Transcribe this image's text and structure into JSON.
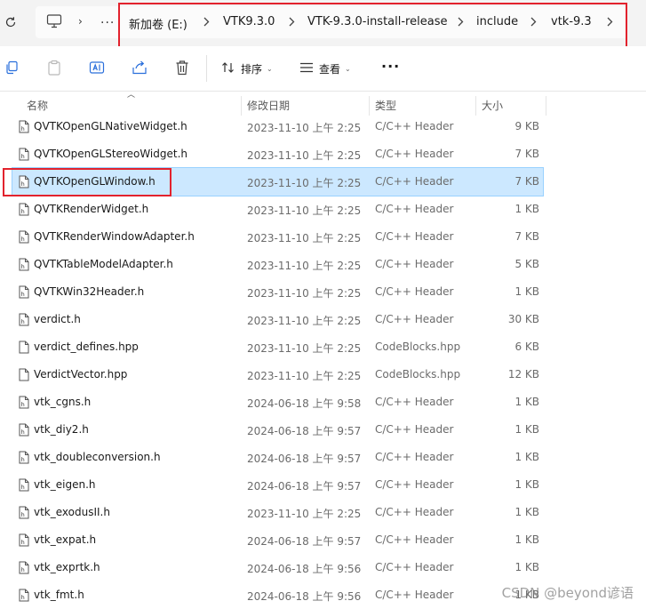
{
  "address": {
    "more": "...",
    "crumbs": [
      "新加卷 (E:)",
      "VTK9.3.0",
      "VTK-9.3.0-install-release",
      "include",
      "vtk-9.3"
    ]
  },
  "toolbar": {
    "sort_label": "排序",
    "view_label": "查看",
    "more_label": "···"
  },
  "columns": {
    "name": "名称",
    "modified": "修改日期",
    "type": "类型",
    "size": "大小"
  },
  "files": [
    {
      "name": "QVTKOpenGLNativeWidget.h",
      "modified": "2023-11-10 上午 2:25",
      "type": "C/C++ Header",
      "size": "9 KB",
      "icon": "header-file-icon"
    },
    {
      "name": "QVTKOpenGLStereoWidget.h",
      "modified": "2023-11-10 上午 2:25",
      "type": "C/C++ Header",
      "size": "7 KB",
      "icon": "header-file-icon"
    },
    {
      "name": "QVTKOpenGLWindow.h",
      "modified": "2023-11-10 上午 2:25",
      "type": "C/C++ Header",
      "size": "7 KB",
      "icon": "header-file-icon"
    },
    {
      "name": "QVTKRenderWidget.h",
      "modified": "2023-11-10 上午 2:25",
      "type": "C/C++ Header",
      "size": "1 KB",
      "icon": "header-file-icon"
    },
    {
      "name": "QVTKRenderWindowAdapter.h",
      "modified": "2023-11-10 上午 2:25",
      "type": "C/C++ Header",
      "size": "7 KB",
      "icon": "header-file-icon"
    },
    {
      "name": "QVTKTableModelAdapter.h",
      "modified": "2023-11-10 上午 2:25",
      "type": "C/C++ Header",
      "size": "5 KB",
      "icon": "header-file-icon"
    },
    {
      "name": "QVTKWin32Header.h",
      "modified": "2023-11-10 上午 2:25",
      "type": "C/C++ Header",
      "size": "1 KB",
      "icon": "header-file-icon"
    },
    {
      "name": "verdict.h",
      "modified": "2023-11-10 上午 2:25",
      "type": "C/C++ Header",
      "size": "30 KB",
      "icon": "header-file-icon"
    },
    {
      "name": "verdict_defines.hpp",
      "modified": "2023-11-10 上午 2:25",
      "type": "CodeBlocks.hpp",
      "size": "6 KB",
      "icon": "blank-file-icon"
    },
    {
      "name": "VerdictVector.hpp",
      "modified": "2023-11-10 上午 2:25",
      "type": "CodeBlocks.hpp",
      "size": "12 KB",
      "icon": "blank-file-icon"
    },
    {
      "name": "vtk_cgns.h",
      "modified": "2024-06-18 上午 9:58",
      "type": "C/C++ Header",
      "size": "1 KB",
      "icon": "header-file-icon"
    },
    {
      "name": "vtk_diy2.h",
      "modified": "2024-06-18 上午 9:57",
      "type": "C/C++ Header",
      "size": "1 KB",
      "icon": "header-file-icon"
    },
    {
      "name": "vtk_doubleconversion.h",
      "modified": "2024-06-18 上午 9:57",
      "type": "C/C++ Header",
      "size": "1 KB",
      "icon": "header-file-icon"
    },
    {
      "name": "vtk_eigen.h",
      "modified": "2024-06-18 上午 9:57",
      "type": "C/C++ Header",
      "size": "1 KB",
      "icon": "header-file-icon"
    },
    {
      "name": "vtk_exodusII.h",
      "modified": "2023-11-10 上午 2:25",
      "type": "C/C++ Header",
      "size": "1 KB",
      "icon": "header-file-icon"
    },
    {
      "name": "vtk_expat.h",
      "modified": "2024-06-18 上午 9:57",
      "type": "C/C++ Header",
      "size": "1 KB",
      "icon": "header-file-icon"
    },
    {
      "name": "vtk_exprtk.h",
      "modified": "2024-06-18 上午 9:56",
      "type": "C/C++ Header",
      "size": "1 KB",
      "icon": "header-file-icon"
    },
    {
      "name": "vtk_fmt.h",
      "modified": "2024-06-18 上午 9:56",
      "type": "C/C++ Header",
      "size": "1 KB",
      "icon": "header-file-icon"
    }
  ],
  "selected_index": 2,
  "watermark": "CSDN @beyond谚语",
  "colors": {
    "accent_blue": "#2a6fdb",
    "selection": "#cce8ff",
    "highlight_red": "#e2222d"
  }
}
